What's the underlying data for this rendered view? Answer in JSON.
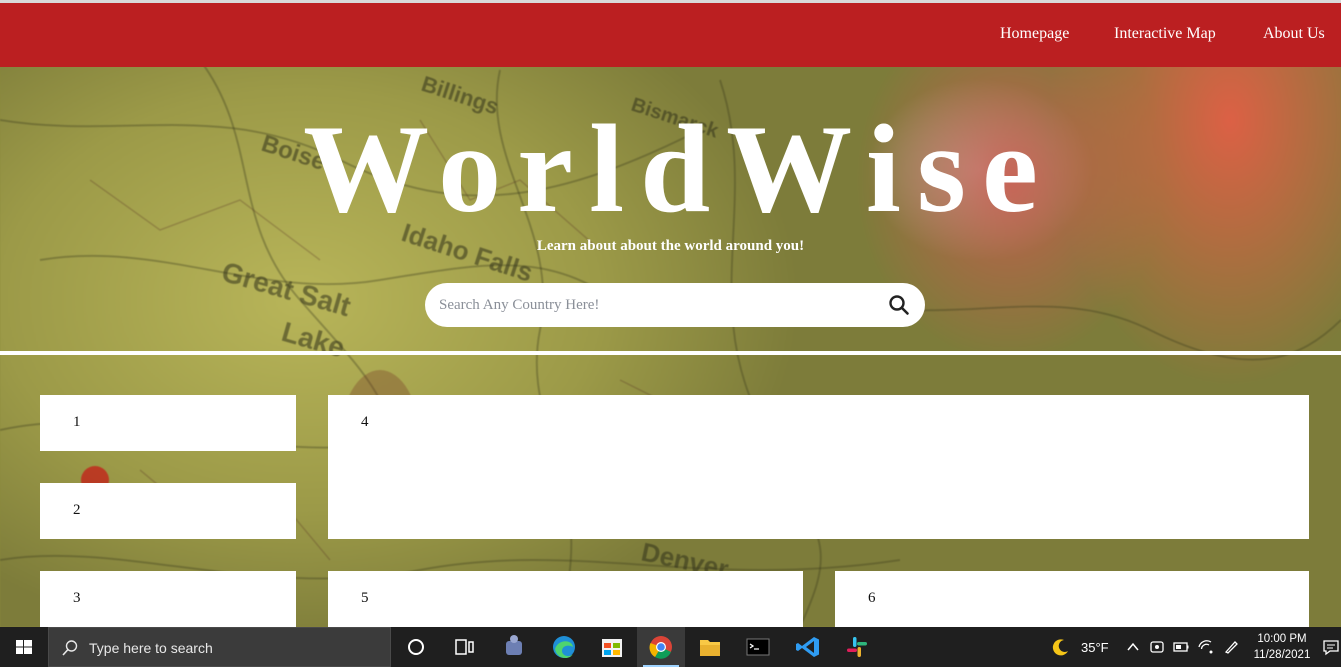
{
  "nav": {
    "links": [
      "Homepage",
      "Interactive Map",
      "About Us"
    ]
  },
  "hero": {
    "title": "WorldWise",
    "subtitle": "Learn about about the world around you!",
    "search_placeholder": "Search Any Country Here!"
  },
  "boxes": [
    "1",
    "2",
    "3",
    "4",
    "5",
    "6"
  ],
  "taskbar": {
    "search_placeholder": "Type here to search",
    "temperature": "35°F",
    "time": "10:00 PM",
    "date": "11/28/2021",
    "apps": [
      "cortana-icon",
      "task-view-icon",
      "app-icon",
      "edge-icon",
      "store-icon",
      "chrome-icon",
      "file-explorer-icon",
      "terminal-icon",
      "vscode-icon",
      "slack-icon"
    ]
  },
  "colors": {
    "navbar": "#bb1f21",
    "text": "#ffffff"
  }
}
